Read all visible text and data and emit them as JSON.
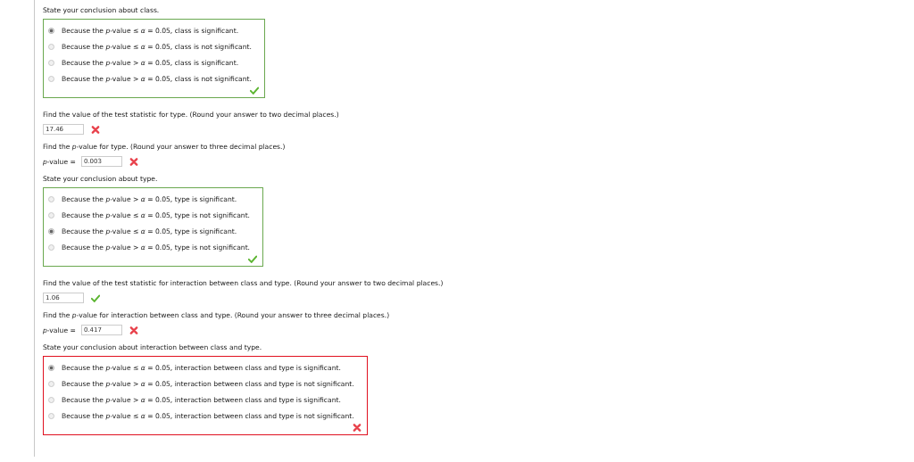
{
  "questions": [
    {
      "kind": "choice",
      "prompt": "State your conclusion about class.",
      "correct": true,
      "options": [
        {
          "text": "Because the *p*-value ≤ *α* = 0.05, class is significant.",
          "selected": true
        },
        {
          "text": "Because the *p*-value ≤ *α* = 0.05, class is not significant.",
          "selected": false
        },
        {
          "text": "Because the *p*-value > *α* = 0.05, class is significant.",
          "selected": false
        },
        {
          "text": "Because the *p*-value > *α* = 0.05, class is not significant.",
          "selected": false
        }
      ]
    },
    {
      "kind": "numeric",
      "prompt": "Find the value of the test statistic for type. (Round your answer to two decimal places.)",
      "value": "17.46",
      "correct": false
    },
    {
      "kind": "numeric",
      "prompt": "Find the *p*-value for type. (Round your answer to three decimal places.)",
      "label": "*p*-value =",
      "value": "0.003",
      "correct": false
    },
    {
      "kind": "choice",
      "prompt": "State your conclusion about type.",
      "correct": true,
      "options": [
        {
          "text": "Because the *p*-value > *α* = 0.05, type is significant.",
          "selected": false
        },
        {
          "text": "Because the *p*-value ≤ *α* = 0.05, type is not significant.",
          "selected": false
        },
        {
          "text": "Because the *p*-value ≤ *α* = 0.05, type is significant.",
          "selected": true
        },
        {
          "text": "Because the *p*-value > *α* = 0.05, type is not significant.",
          "selected": false
        }
      ]
    },
    {
      "kind": "numeric",
      "prompt": "Find the value of the test statistic for interaction between class and type. (Round your answer to two decimal places.)",
      "value": "1.06",
      "correct": true
    },
    {
      "kind": "numeric",
      "prompt": "Find the *p*-value for interaction between class and type. (Round your answer to three decimal places.)",
      "label": "*p*-value =",
      "value": "0.417",
      "correct": false
    },
    {
      "kind": "choice",
      "prompt": "State your conclusion about interaction between class and type.",
      "correct": false,
      "options": [
        {
          "text": "Because the *p*-value ≤ *α* = 0.05, interaction between class and type is significant.",
          "selected": true
        },
        {
          "text": "Because the *p*-value > *α* = 0.05, interaction between class and type is not significant.",
          "selected": false
        },
        {
          "text": "Because the *p*-value > *α* = 0.05, interaction between class and type is significant.",
          "selected": false
        },
        {
          "text": "Because the *p*-value ≤ *α* = 0.05, interaction between class and type is not significant.",
          "selected": false
        }
      ]
    }
  ]
}
